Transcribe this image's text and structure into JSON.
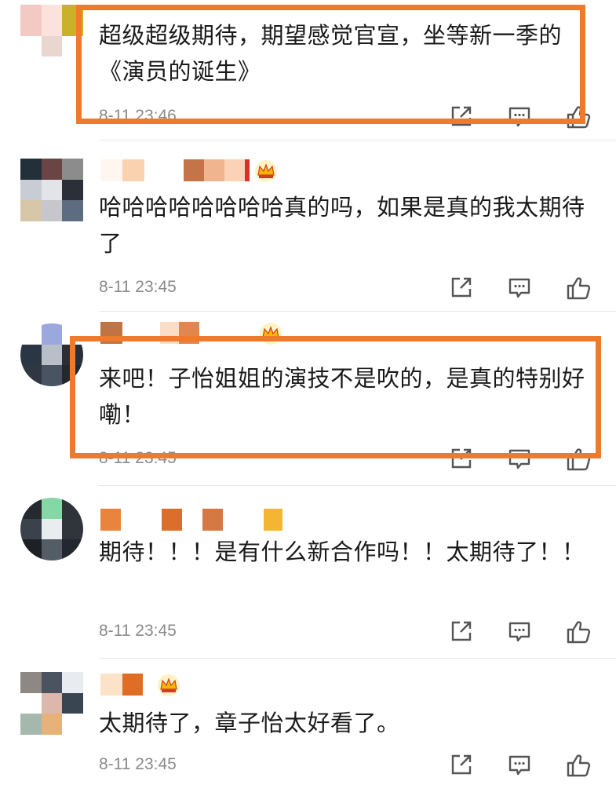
{
  "comments": [
    {
      "text": "超级超级期待，期望感觉官宣，坐等新一季的《演员的诞生》",
      "time": "8-11 23:46"
    },
    {
      "text": "哈哈哈哈哈哈哈哈真的吗，如果是真的我太期待了",
      "time": "8-11 23:45"
    },
    {
      "text": "来吧！子怡姐姐的演技不是吹的，是真的特别好嘞！",
      "time": "8-11 23:45"
    },
    {
      "text": "期待！！！是有什么新合作吗！！太期待了！！",
      "time": "8-11 23:45"
    },
    {
      "text": "太期待了，章子怡太好看了。",
      "time": "8-11 23:45"
    }
  ],
  "icons": {
    "share": "share-icon",
    "comment": "comment-icon",
    "like": "thumbs-up-icon",
    "crown": "vip-crown-icon"
  },
  "colors": {
    "highlight": "#f07a2c",
    "time": "#8a8a8a",
    "crown": "#f5b800"
  }
}
